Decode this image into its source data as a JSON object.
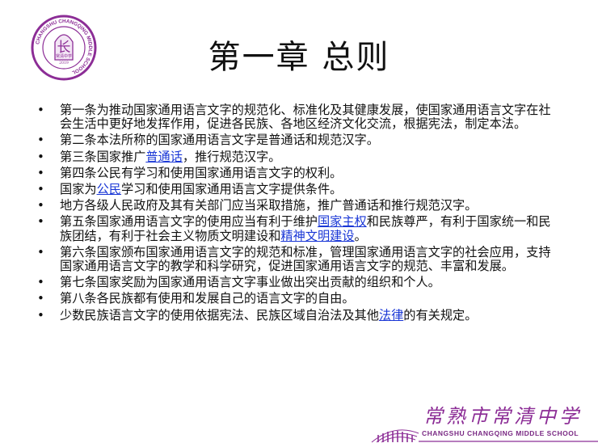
{
  "logo": {
    "ring_text": "CHANGSHU CHANGQING MIDDLE SCHOOL",
    "center_char": "长",
    "small_text": "常清中学",
    "year": "2019"
  },
  "title": "第一章  总则",
  "articles": [
    {
      "parts": [
        {
          "text": "第一条为推动国家通用语言文字的规范化、标准化及其健康发展，使国家通用语言文字在社会生活中更好地发挥作用，促进各民族、各地区经济文化交流，根据宪法，制定本法。"
        }
      ]
    },
    {
      "parts": [
        {
          "text": "第二条本法所称的国家通用语言文字是普通话和规范汉字。"
        }
      ]
    },
    {
      "parts": [
        {
          "text": "第三条国家推广"
        },
        {
          "text": "普通话",
          "link": true
        },
        {
          "text": "，推行规范汉字。"
        }
      ]
    },
    {
      "parts": [
        {
          "text": "第四条公民有学习和使用国家通用语言文字的权利。"
        }
      ]
    },
    {
      "parts": [
        {
          "text": "国家为"
        },
        {
          "text": "公民",
          "link": true
        },
        {
          "text": "学习和使用国家通用语言文字提供条件。"
        }
      ]
    },
    {
      "parts": [
        {
          "text": "地方各级人民政府及其有关部门应当采取措施，推广普通话和推行规范汉字。"
        }
      ]
    },
    {
      "parts": [
        {
          "text": "第五条国家通用语言文字的使用应当有利于维护"
        },
        {
          "text": "国家主权",
          "link": true
        },
        {
          "text": "和民族尊严，有利于国家统一和民族团结，有利于社会主义物质文明建设和"
        },
        {
          "text": "精神文明建设",
          "link": true
        },
        {
          "text": "。"
        }
      ]
    },
    {
      "parts": [
        {
          "text": "第六条国家颁布国家通用语言文字的规范和标准，管理国家通用语言文字的社会应用，支持国家通用语言文字的教学和科学研究，促进国家通用语言文字的规范、丰富和发展。"
        }
      ]
    },
    {
      "parts": [
        {
          "text": "第七条国家奖励为国家通用语言文字事业做出突出贡献的组织和个人。"
        }
      ]
    },
    {
      "parts": [
        {
          "text": "第八条各民族都有使用和发展自己的语言文字的自由。"
        }
      ]
    },
    {
      "parts": [
        {
          "text": "少数民族语言文字的使用依据宪法、民族区域自治法及其他"
        },
        {
          "text": "法律",
          "link": true
        },
        {
          "text": "的有关规定。"
        }
      ]
    }
  ],
  "footer": {
    "school_name_cn": "常熟市常清中学",
    "school_name_en": "CHANGSHU CHANGQING MIDDLE SCHOOL"
  },
  "colors": {
    "brand_purple": "#8c2d96",
    "link_blue": "#1a37d6"
  }
}
